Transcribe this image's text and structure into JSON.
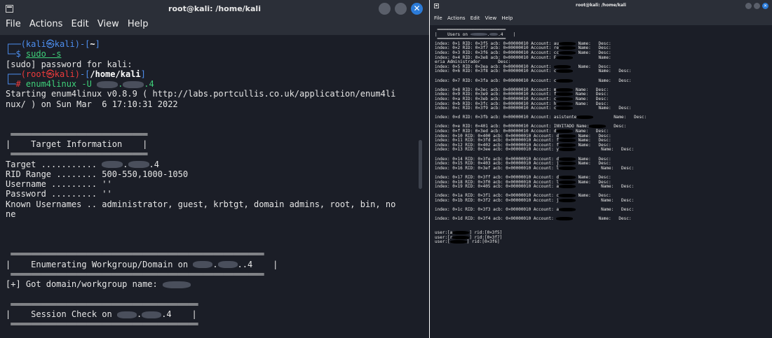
{
  "left_window": {
    "title": "root@kali: /home/kali",
    "close_glyph": "✕",
    "menu": [
      "File",
      "Actions",
      "Edit",
      "View",
      "Help"
    ],
    "terminal": {
      "prompt1_user": "(kali㉿kali)",
      "prompt1_dir": "~",
      "cmd1_prompt": "$ ",
      "cmd1": "sudo -s",
      "sudo_msg": "[sudo] password for kali:",
      "prompt2_user": "(root㉿kali)",
      "prompt2_dir": "/home/kali",
      "cmd2_prompt": "# ",
      "cmd2_a": "enum4linux -U ",
      "cmd2_b": ".4",
      "start_line1": "Starting enum4linux v0.8.9 ( http://labs.portcullis.co.uk/application/enum4li",
      "start_line2": "nux/ ) on Sun Mar  6 17:10:31 2022",
      "box1_title": "Target Information",
      "target_label": "Target ........... ",
      "target_suffix": ".4",
      "rid_range": "RID Range ........ 500-550,1000-1050",
      "username": "Username ......... ''",
      "password": "Password ......... ''",
      "known_users1": "Known Usernames .. administrator, guest, krbtgt, domain admins, root, bin, no",
      "known_users2": "ne",
      "box2_title_a": "Enumerating Workgroup/Domain on ",
      "box2_title_b": ".4",
      "got_domain": "[+] Got domain/workgroup name: ",
      "box3_title_a": "Session Check on ",
      "box3_title_b": ".4"
    }
  },
  "right_window": {
    "title": "root@kali: /home/kali",
    "close_glyph": "✕",
    "menu": [
      "File",
      "Actions",
      "Edit",
      "View",
      "Help"
    ],
    "header_box": "Users on",
    "header_suffix": ".4",
    "entries": [
      {
        "t": "index: 0×1 RID: 0×3f5 acb: 0×00000010 Account: au",
        "mid": " Name:   Desc:"
      },
      {
        "t": "index: 0×2 RID: 0×3f7 acb: 0×00000010 Account: re",
        "mid": " Name:   Desc:"
      },
      {
        "t": "index: 0×3 RID: 0×3f6 acb: 0×00000010 Account: cc",
        "mid": " Name:   Desc:"
      },
      {
        "t": "index: 0×4 RID: 0×3e8 acb: 0×00000010 Account: F",
        "mid": "          Name: "
      },
      {
        "t": "eria Administrador       Desc:",
        "mid": ""
      },
      {
        "t": "index: 0×5 RID: 0×3ea acb: 0×00000010 Account: ",
        "mid": "   Name:   Desc:"
      },
      {
        "t": "index: 0×6 RID: 0×3f8 acb: 0×00000010 Account: c",
        "mid": "          Name:   Desc:"
      },
      {
        "t": "",
        "mid": ""
      },
      {
        "t": "index: 0×7 RID: 0×3fa acb: 0×00000010 Account: c",
        "mid": "          Name:   Desc:"
      },
      {
        "t": "",
        "mid": ""
      },
      {
        "t": "index: 0×8 RID: 0×3ec acb: 0×00000010 Account: m",
        "mid": " Name:   Desc:"
      },
      {
        "t": "index: 0×9 RID: 0×3e9 acb: 0×00000010 Account: f",
        "mid": " Name:   Desc:"
      },
      {
        "t": "index: 0×a RID: 0×3eb acb: 0×00000010 Account: c",
        "mid": " Name:   Desc:"
      },
      {
        "t": "index: 0×b RID: 0×3fc acb: 0×00000010 Account: h",
        "mid": " Name:   Desc:"
      },
      {
        "t": "index: 0×c RID: 0×3f9 acb: 0×00000010 Account: c",
        "mid": "          Name:   Desc:"
      },
      {
        "t": "",
        "mid": ""
      },
      {
        "t": "index: 0×d RID: 0×3fb acb: 0×00000010 Account: asistente",
        "mid": "        Name:   Desc:"
      },
      {
        "t": "",
        "mid": ""
      },
      {
        "t": "index: 0×e RID: 0×401 acb: 0×00000010 Account: INVITADO Name:",
        "mid": "   Desc:"
      },
      {
        "t": "index: 0×f RID: 0×3ed acb: 0×00000010 Account: d",
        "mid": " Name:   Desc:"
      },
      {
        "t": "index: 0×10 RID: 0×400 acb: 0×00000010 Account: d",
        "mid": " Name:   Desc:"
      },
      {
        "t": "index: 0×11 RID: 0×3fd acb: 0×00000010 Account: f",
        "mid": " Name:   Desc:"
      },
      {
        "t": "index: 0×12 RID: 0×402 acb: 0×00000010 Account: f",
        "mid": " Name:   Desc:"
      },
      {
        "t": "index: 0×13 RID: 0×3ee acb: 0×00000010 Account: y",
        "mid": "          Name:   Desc:"
      },
      {
        "t": "",
        "mid": ""
      },
      {
        "t": "index: 0×14 RID: 0×3fe acb: 0×00000010 Account: d",
        "mid": " Name:   Desc:"
      },
      {
        "t": "index: 0×15 RID: 0×403 acb: 0×00000010 Account: j",
        "mid": " Name:   Desc:"
      },
      {
        "t": "index: 0×16 RID: 0×3ef acb: 0×00000010 Account: l",
        "mid": "          Name:   Desc:"
      },
      {
        "t": "",
        "mid": ""
      },
      {
        "t": "index: 0×17 RID: 0×3ff acb: 0×00000010 Account: d",
        "mid": " Name:   Desc:"
      },
      {
        "t": "index: 0×18 RID: 0×3f0 acb: 0×00000010 Account: l",
        "mid": " Name:   Desc:"
      },
      {
        "t": "index: 0×19 RID: 0×405 acb: 0×00000010 Account: a",
        "mid": "          Name:   Desc:"
      },
      {
        "t": "",
        "mid": ""
      },
      {
        "t": "index: 0×1a RID: 0×3f1 acb: 0×00000010 Account: c",
        "mid": " Name:   Desc:"
      },
      {
        "t": "index: 0×1b RID: 0×3f2 acb: 0×00000010 Account: j",
        "mid": "          Name:   Desc:"
      },
      {
        "t": "",
        "mid": ""
      },
      {
        "t": "index: 0×1c RID: 0×3f3 acb: 0×00000010 Account: a",
        "mid": "          Name:   Desc:"
      },
      {
        "t": "",
        "mid": ""
      },
      {
        "t": "index: 0×1d RID: 0×3f4 acb: 0×00000010 Account: ",
        "mid": "          Name:   Desc:"
      }
    ],
    "user_rids": [
      {
        "a": "user:[a",
        "b": "] rid:[0×3f5]"
      },
      {
        "a": "user:[r",
        "b": "] rid:[0×3f7]"
      },
      {
        "a": "user:[",
        "b": "] rid:[0×3f6]"
      }
    ]
  }
}
